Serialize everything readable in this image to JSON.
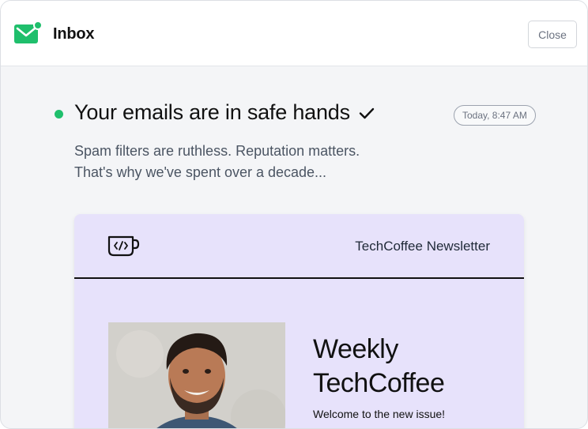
{
  "app": {
    "title": "Inbox",
    "close_label": "Close"
  },
  "icons": {
    "app": "mail-icon",
    "check": "check-icon",
    "logo": "coffee-code-icon"
  },
  "colors": {
    "accent": "#1fbf6c",
    "newsletter_bg": "#e7e2fb"
  },
  "message": {
    "subject": "Your emails are in safe hands",
    "timestamp": "Today, 8:47 AM",
    "preview_lines": [
      "Spam filters are ruthless. Reputation matters.",
      "That's why we've spent over a decade..."
    ]
  },
  "newsletter": {
    "name": "TechCoffee Newsletter",
    "heading_lines": [
      "Weekly",
      "TechCoffee"
    ],
    "subheading": "Welcome to the new issue!"
  }
}
